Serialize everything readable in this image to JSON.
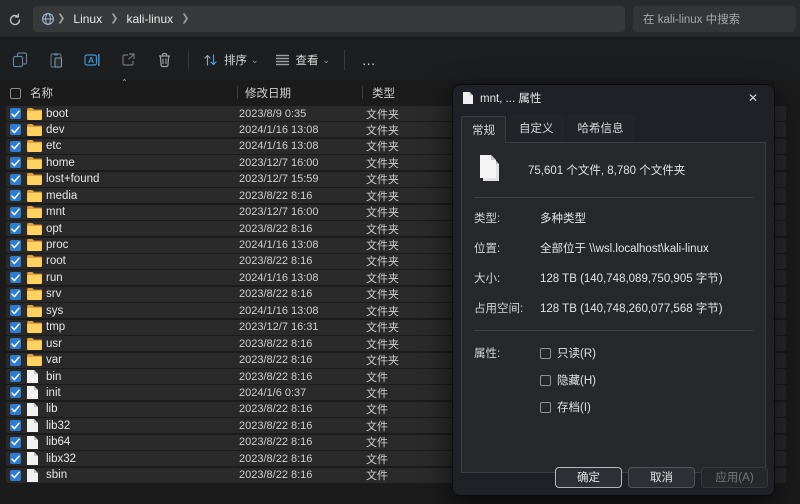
{
  "address": {
    "crumbs": [
      "Linux",
      "kali-linux"
    ],
    "search_placeholder": "在 kali-linux 中搜索"
  },
  "toolbar": {
    "sort_label": "排序",
    "view_label": "查看",
    "more_label": "…",
    "icons": [
      "refresh-icon",
      "copy-icon",
      "paste-icon",
      "rename-icon",
      "share-icon",
      "delete-icon",
      "sort-icon",
      "view-icon",
      "more-icon"
    ]
  },
  "list": {
    "headers": {
      "name": "名称",
      "date": "修改日期",
      "type": "类型"
    },
    "rows": [
      {
        "name": "boot",
        "date": "2023/8/9 0:35",
        "type": "文件夹",
        "icon": "folder"
      },
      {
        "name": "dev",
        "date": "2024/1/16 13:08",
        "type": "文件夹",
        "icon": "folder"
      },
      {
        "name": "etc",
        "date": "2024/1/16 13:08",
        "type": "文件夹",
        "icon": "folder"
      },
      {
        "name": "home",
        "date": "2023/12/7 16:00",
        "type": "文件夹",
        "icon": "folder"
      },
      {
        "name": "lost+found",
        "date": "2023/12/7 15:59",
        "type": "文件夹",
        "icon": "folder"
      },
      {
        "name": "media",
        "date": "2023/8/22 8:16",
        "type": "文件夹",
        "icon": "folder"
      },
      {
        "name": "mnt",
        "date": "2023/12/7 16:00",
        "type": "文件夹",
        "icon": "folder"
      },
      {
        "name": "opt",
        "date": "2023/8/22 8:16",
        "type": "文件夹",
        "icon": "folder"
      },
      {
        "name": "proc",
        "date": "2024/1/16 13:08",
        "type": "文件夹",
        "icon": "folder"
      },
      {
        "name": "root",
        "date": "2023/8/22 8:16",
        "type": "文件夹",
        "icon": "folder"
      },
      {
        "name": "run",
        "date": "2024/1/16 13:08",
        "type": "文件夹",
        "icon": "folder"
      },
      {
        "name": "srv",
        "date": "2023/8/22 8:16",
        "type": "文件夹",
        "icon": "folder"
      },
      {
        "name": "sys",
        "date": "2024/1/16 13:08",
        "type": "文件夹",
        "icon": "folder"
      },
      {
        "name": "tmp",
        "date": "2023/12/7 16:31",
        "type": "文件夹",
        "icon": "folder"
      },
      {
        "name": "usr",
        "date": "2023/8/22 8:16",
        "type": "文件夹",
        "icon": "folder"
      },
      {
        "name": "var",
        "date": "2023/8/22 8:16",
        "type": "文件夹",
        "icon": "folder"
      },
      {
        "name": "bin",
        "date": "2023/8/22 8:16",
        "type": "文件",
        "icon": "file"
      },
      {
        "name": "init",
        "date": "2024/1/6 0:37",
        "type": "文件",
        "icon": "file"
      },
      {
        "name": "lib",
        "date": "2023/8/22 8:16",
        "type": "文件",
        "icon": "file"
      },
      {
        "name": "lib32",
        "date": "2023/8/22 8:16",
        "type": "文件",
        "icon": "file"
      },
      {
        "name": "lib64",
        "date": "2023/8/22 8:16",
        "type": "文件",
        "icon": "file"
      },
      {
        "name": "libx32",
        "date": "2023/8/22 8:16",
        "type": "文件",
        "icon": "file"
      },
      {
        "name": "sbin",
        "date": "2023/8/22 8:16",
        "type": "文件",
        "icon": "file"
      }
    ]
  },
  "dialog": {
    "title": "mnt, ... 属性",
    "tabs": [
      {
        "label": "常规"
      },
      {
        "label": "自定义"
      },
      {
        "label": "哈希信息"
      }
    ],
    "summary": "75,601 个文件, 8,780 个文件夹",
    "details": [
      {
        "label": "类型:",
        "value": "多种类型"
      },
      {
        "label": "位置:",
        "value": "全部位于 \\\\wsl.localhost\\kali-linux"
      },
      {
        "label": "大小:",
        "value": "128 TB (140,748,089,750,905 字节)"
      },
      {
        "label": "占用空间:",
        "value": "128 TB (140,748,260,077,568 字节)"
      }
    ],
    "attributes_label": "属性:",
    "attributes": [
      {
        "label": "只读(R)",
        "checked": false
      },
      {
        "label": "隐藏(H)",
        "checked": false
      },
      {
        "label": "存档(I)",
        "checked": false
      }
    ],
    "buttons": {
      "ok": "确定",
      "cancel": "取消",
      "apply": "应用(A)"
    }
  },
  "colors": {
    "accent_checkbox": "#2b7cd3",
    "folder_yellow": "#ffd261",
    "dialog_bg": "#1f2127",
    "panel_bg": "#26282c"
  }
}
